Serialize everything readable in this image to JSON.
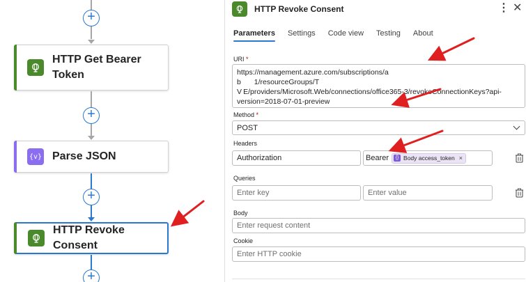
{
  "canvas": {
    "cards": [
      {
        "title": "HTTP Get Bearer Token",
        "lines": [
          "HTTP Get Bearer",
          "Token"
        ],
        "icon": "globe-icon",
        "accent": "#4a8a2c"
      },
      {
        "title": "Parse JSON",
        "icon": "braces-icon",
        "accent": "#8b6ef0"
      },
      {
        "title": "HTTP Revoke Consent",
        "icon": "globe-icon",
        "accent": "#4a8a2c",
        "selected": true
      }
    ],
    "add_symbol": "+"
  },
  "panel": {
    "title": "HTTP Revoke Consent",
    "more_symbol": "⋮",
    "close_symbol": "✕",
    "tabs": [
      {
        "label": "Parameters",
        "active": true
      },
      {
        "label": "Settings"
      },
      {
        "label": "Code view"
      },
      {
        "label": "Testing"
      },
      {
        "label": "About"
      }
    ],
    "uri": {
      "label": "URI",
      "required": "*",
      "value": "https://management.azure.com/subscriptions/a                    \nb         1/resourceGroups/T\nV E/providers/Microsoft.Web/connections/office365-3/revokeConnectionKeys?api-\nversion=2018-07-01-preview"
    },
    "method": {
      "label": "Method",
      "required": "*",
      "value": "POST"
    },
    "headers": {
      "label": "Headers",
      "key": "Authorization",
      "value_prefix": "Bearer",
      "token_label": "Body access_token",
      "token_remove": "×"
    },
    "queries": {
      "label": "Queries",
      "key_placeholder": "Enter key",
      "value_placeholder": "Enter value"
    },
    "body": {
      "label": "Body",
      "placeholder": "Enter request content"
    },
    "cookie": {
      "label": "Cookie",
      "placeholder": "Enter HTTP cookie"
    }
  },
  "colors": {
    "accent_blue": "#2a78d0",
    "http_green": "#4a8a2c",
    "parse_purple": "#8b6ef0",
    "annotation_red": "#e02020"
  }
}
